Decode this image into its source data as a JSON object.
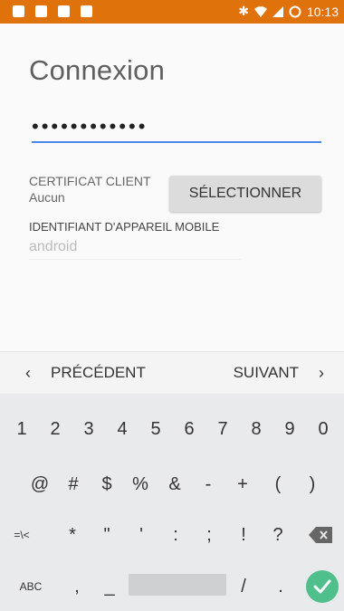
{
  "status_bar": {
    "time": "10:13",
    "left_icons": [
      "notification-icon",
      "image-icon",
      "chat-icon",
      "message-icon"
    ],
    "right_icons": [
      "bluetooth-icon",
      "wifi-icon",
      "signal-icon",
      "battery-icon"
    ],
    "background": "#e0720c"
  },
  "form": {
    "title": "Connexion",
    "password_masked": "••••••••••••",
    "client_cert_label": "CERTIFICAT CLIENT",
    "client_cert_value": "Aucun",
    "select_button": "SÉLECTIONNER",
    "device_id_label": "IDENTIFIANT D'APPAREIL MOBILE",
    "device_id_value": "android"
  },
  "nav": {
    "prev_label": "PRÉCÉDENT",
    "next_label": "SUIVANT"
  },
  "keyboard": {
    "row1": [
      "1",
      "2",
      "3",
      "4",
      "5",
      "6",
      "7",
      "8",
      "9",
      "0"
    ],
    "row2": [
      "@",
      "#",
      "$",
      "%",
      "&",
      "-",
      "+",
      "(",
      ")"
    ],
    "row3": [
      "=\\<",
      "*",
      "\"",
      "'",
      ":",
      ";",
      "!",
      "?"
    ],
    "row4_left": "ABC",
    "row4_keys": [
      ",",
      "_",
      "/",
      "."
    ]
  }
}
